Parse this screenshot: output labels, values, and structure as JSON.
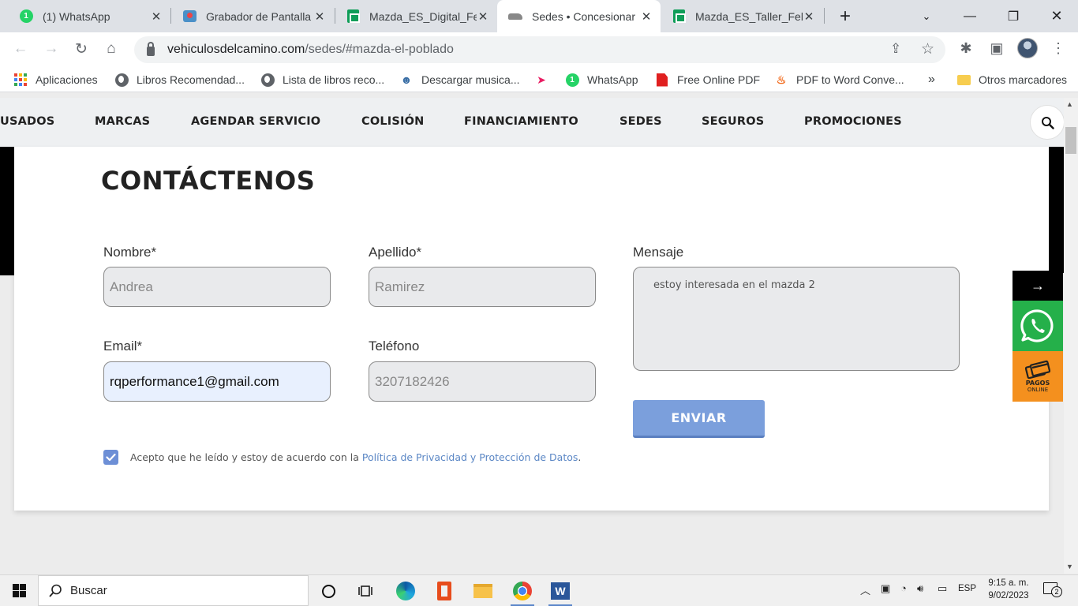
{
  "browser": {
    "tabs": [
      {
        "title": "(1) WhatsApp",
        "icon": "whatsapp-icon",
        "badge": "1"
      },
      {
        "title": "Grabador de Pantalla",
        "icon": "screen-recorder-icon"
      },
      {
        "title": "Mazda_ES_Digital_Fe",
        "icon": "google-sheets-icon"
      },
      {
        "title": "Sedes • Concesionar",
        "icon": "car-icon",
        "active": true
      },
      {
        "title": "Mazda_ES_Taller_Feb",
        "icon": "google-sheets-icon"
      }
    ],
    "url_host": "vehiculosdelcamino.com",
    "url_path": "/sedes/#mazda-el-poblado",
    "bookmarks": [
      {
        "label": "Aplicaciones",
        "icon": "apps-grid-icon"
      },
      {
        "label": "Libros Recomendad...",
        "icon": "globe-icon"
      },
      {
        "label": "Lista de libros reco...",
        "icon": "globe-icon"
      },
      {
        "label": "Descargar musica...",
        "icon": "music-download-icon"
      },
      {
        "label": "",
        "icon": "send-plane-icon"
      },
      {
        "label": "WhatsApp",
        "icon": "whatsapp-icon"
      },
      {
        "label": "Free Online PDF",
        "icon": "pdf-icon"
      },
      {
        "label": "PDF to Word Conve...",
        "icon": "pdf-convert-icon"
      }
    ],
    "bookmarks_more": "»",
    "other_bookmarks": "Otros marcadores"
  },
  "site": {
    "nav": [
      "USADOS",
      "MARCAS",
      "AGENDAR SERVICIO",
      "COLISIÓN",
      "FINANCIAMIENTO",
      "SEDES",
      "SEGUROS",
      "PROMOCIONES"
    ]
  },
  "form": {
    "heading": "CONTÁCTENOS",
    "nombre_label": "Nombre*",
    "nombre_placeholder": "Andrea",
    "apellido_label": "Apellido*",
    "apellido_placeholder": "Ramirez",
    "mensaje_label": "Mensaje",
    "mensaje_value": "estoy interesada en el mazda 2",
    "email_label": "Email*",
    "email_value": "rqperformance1@gmail.com",
    "telefono_label": "Teléfono",
    "telefono_placeholder": "3207182426",
    "send_label": "ENVIAR",
    "consent_text": "Acepto que he leído y estoy de acuerdo con la ",
    "consent_link": "Política de Privacidad y Protección de Datos",
    "consent_end": ".",
    "consent_checked": true
  },
  "floating": {
    "arrow": "→",
    "pay_title": "PAGOS",
    "pay_sub": "ONLINE"
  },
  "taskbar": {
    "search_placeholder": "Buscar",
    "language": "ESP",
    "time": "9:15 a. m.",
    "date": "9/02/2023",
    "notifications": "2"
  },
  "colors": {
    "accent": "#7b9fdc",
    "link": "#5b87c5",
    "whatsapp": "#25b04a",
    "pay": "#f4901e"
  }
}
